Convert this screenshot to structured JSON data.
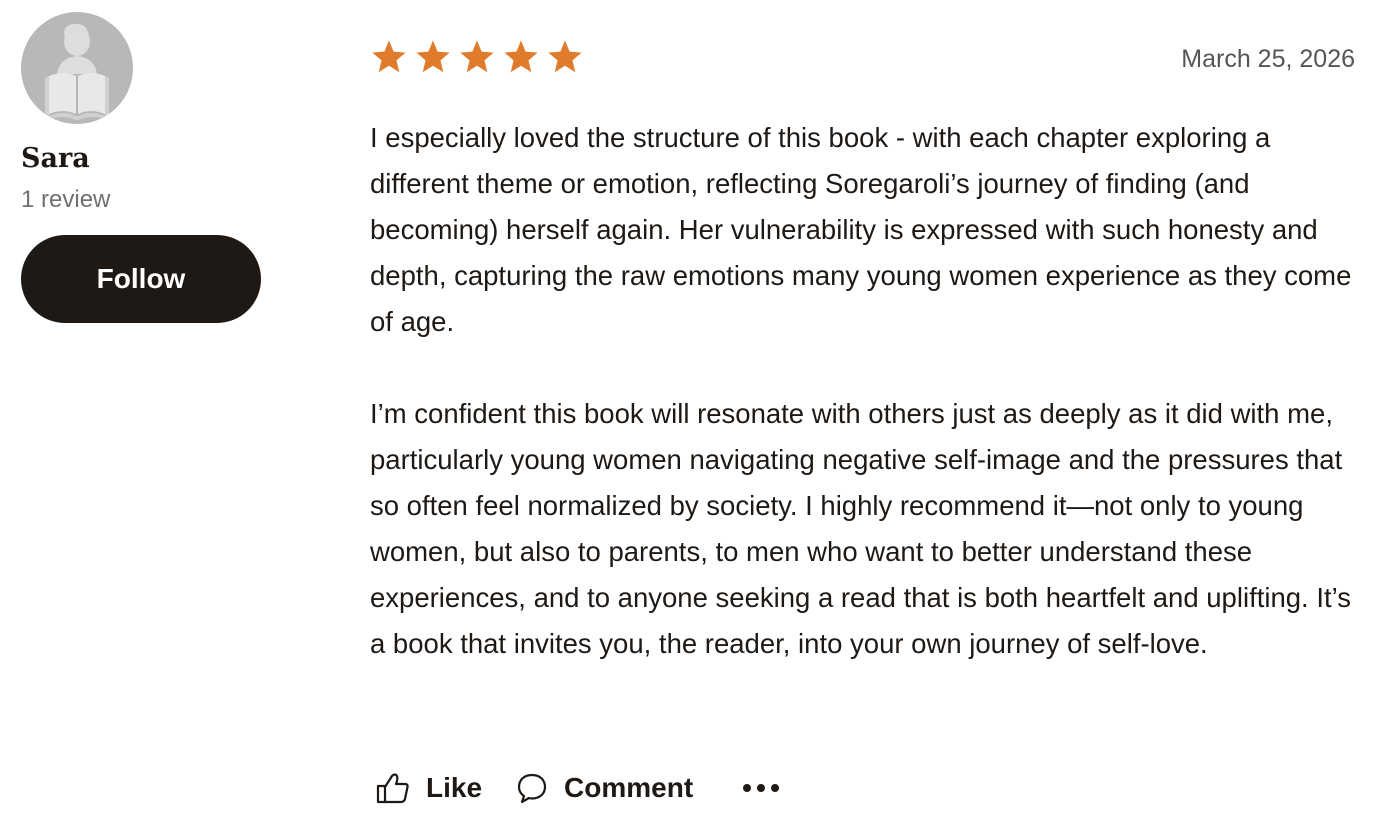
{
  "reviewer": {
    "name": "Sara",
    "review_count": "1 review",
    "follow_label": "Follow",
    "avatar_icon": "reader-silhouette-icon"
  },
  "review": {
    "rating": 5,
    "rating_max": 5,
    "star_color": "#e07b2b",
    "date": "March 25, 2026",
    "paragraphs": [
      "I especially loved the structure of this book - with each chapter exploring a different theme or emotion, reflecting Soregaroli’s journey of finding (and becoming) herself again. Her vulnerability is expressed with such honesty and depth, capturing the raw emotions many young women experience as they come of age.",
      "I’m confident this book will resonate with others just as deeply as it did with me, particularly young women navigating negative self-image and the pressures that so often feel normalized by society. I highly recommend it—not only to young women, but also to parents, to men who want to better understand these experiences, and to anyone seeking a read that is both heartfelt and uplifting. It’s a book that invites you, the reader, into your own journey of self-love."
    ]
  },
  "actions": {
    "like_label": "Like",
    "comment_label": "Comment",
    "like_icon": "thumbs-up-icon",
    "comment_icon": "comment-bubble-icon",
    "more_icon": "more-options-icon"
  }
}
